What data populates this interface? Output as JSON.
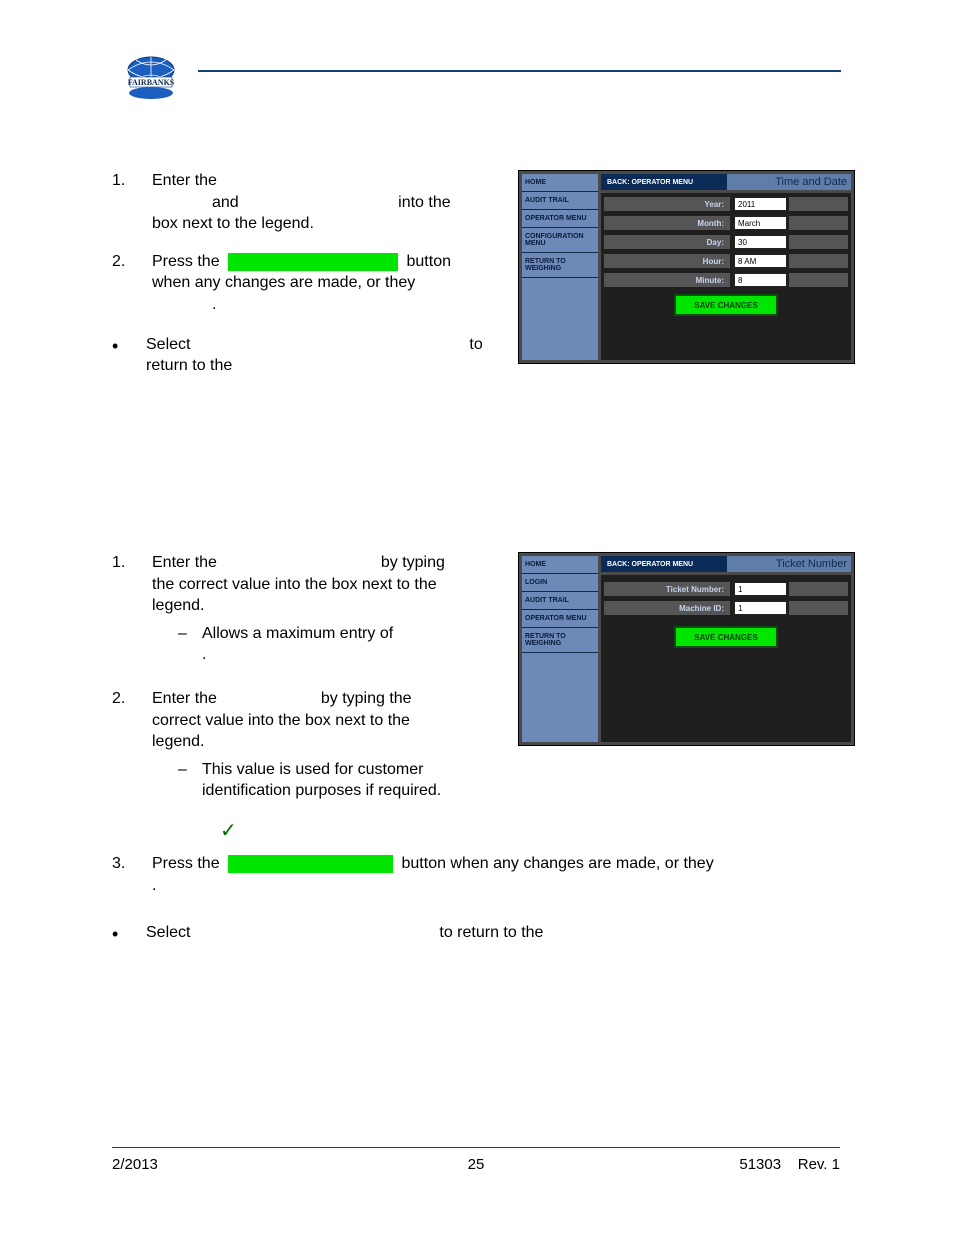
{
  "footer": {
    "left": "2/2013",
    "center": "25",
    "right_a": "51303",
    "right_b": "Rev. 1"
  },
  "section1": {
    "step1": {
      "n": "1.",
      "line1_a": "Enter the",
      "line2_a": "and",
      "line2_b": "into the",
      "line3": "box next to the legend."
    },
    "step2": {
      "n": "2.",
      "line1_a": "Press the",
      "line1_b": "button",
      "line2": "when any changes are made, or they",
      "line3": "."
    },
    "bullet": {
      "a": "Select",
      "b": "to",
      "c": "return to the"
    }
  },
  "section2": {
    "step1": {
      "n": "1.",
      "line1": "Enter the",
      "line1_b": "by typing",
      "line2": "the correct value into the box next to the",
      "line3": "legend.",
      "sub_a": "Allows a maximum entry of",
      "sub_b": "."
    },
    "step2": {
      "n": "2.",
      "line1": "Enter the",
      "line1_b": "by typing the",
      "line2": "correct value into the box next to the",
      "line3": "legend.",
      "sub_a": "This value is used for customer",
      "sub_b": "identification purposes if required."
    },
    "step3": {
      "n": "3.",
      "line1_a": "Press the",
      "line1_b": "button when any changes are made, or they",
      "line2": "."
    },
    "bullet": {
      "a": "Select",
      "b": "to return to the"
    }
  },
  "shot1": {
    "back": "BACK: OPERATOR MENU",
    "title": "Time and Date",
    "side": [
      "HOME",
      "AUDIT TRAIL",
      "OPERATOR MENU",
      "CONFIGURATION MENU",
      "RETURN TO WEIGHING"
    ],
    "rows": [
      {
        "label": "Year:",
        "value": "2011"
      },
      {
        "label": "Month:",
        "value": "March"
      },
      {
        "label": "Day:",
        "value": "30"
      },
      {
        "label": "Hour:",
        "value": "8 AM"
      },
      {
        "label": "Minute:",
        "value": "8"
      }
    ],
    "save": "SAVE CHANGES"
  },
  "shot2": {
    "back": "BACK: OPERATOR MENU",
    "title": "Ticket Number",
    "side": [
      "HOME",
      "LOGIN",
      "AUDIT TRAIL",
      "OPERATOR MENU",
      "RETURN TO WEIGHING"
    ],
    "rows": [
      {
        "label": "Ticket Number:",
        "value": "1"
      },
      {
        "label": "Machine ID:",
        "value": "1"
      }
    ],
    "save": "SAVE CHANGES"
  }
}
